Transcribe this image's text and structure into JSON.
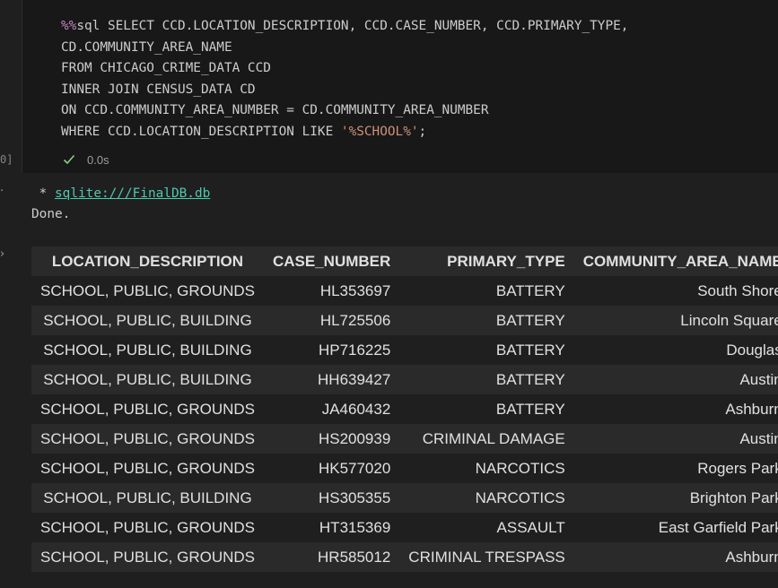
{
  "cell": {
    "code_lines": [
      [
        "%%",
        "sql SELECT CCD.LOCATION_DESCRIPTION, CCD.CASE_NUMBER, CCD.PRIMARY_TYPE,"
      ],
      [
        "",
        "CD.COMMUNITY_AREA_NAME"
      ],
      [
        "",
        "FROM CHICAGO_CRIME_DATA CCD"
      ],
      [
        "",
        "INNER JOIN CENSUS_DATA CD"
      ],
      [
        "",
        "ON CCD.COMMUNITY_AREA_NUMBER = CD.COMMUNITY_AREA_NUMBER"
      ]
    ],
    "where_prefix": "WHERE CCD.LOCATION_DESCRIPTION LIKE ",
    "where_string": "'%SCHOOL%'",
    "where_suffix": ";",
    "exec_count_fragment": "0]",
    "status_icon": "check-icon",
    "exec_time": "0.0s"
  },
  "output": {
    "conn_prefix": " * ",
    "conn_link": "sqlite:///FinalDB.db",
    "done_text": "Done."
  },
  "table": {
    "columns": [
      "LOCATION_DESCRIPTION",
      "CASE_NUMBER",
      "PRIMARY_TYPE",
      "COMMUNITY_AREA_NAME"
    ],
    "rows": [
      [
        "SCHOOL, PUBLIC, GROUNDS",
        "HL353697",
        "BATTERY",
        "South Shore"
      ],
      [
        "SCHOOL, PUBLIC, BUILDING",
        "HL725506",
        "BATTERY",
        "Lincoln Square"
      ],
      [
        "SCHOOL, PUBLIC, BUILDING",
        "HP716225",
        "BATTERY",
        "Douglas"
      ],
      [
        "SCHOOL, PUBLIC, BUILDING",
        "HH639427",
        "BATTERY",
        "Austin"
      ],
      [
        "SCHOOL, PUBLIC, GROUNDS",
        "JA460432",
        "BATTERY",
        "Ashburn"
      ],
      [
        "SCHOOL, PUBLIC, GROUNDS",
        "HS200939",
        "CRIMINAL DAMAGE",
        "Austin"
      ],
      [
        "SCHOOL, PUBLIC, GROUNDS",
        "HK577020",
        "NARCOTICS",
        "Rogers Park"
      ],
      [
        "SCHOOL, PUBLIC, BUILDING",
        "HS305355",
        "NARCOTICS",
        "Brighton Park"
      ],
      [
        "SCHOOL, PUBLIC, GROUNDS",
        "HT315369",
        "ASSAULT",
        "East Garfield Park"
      ],
      [
        "SCHOOL, PUBLIC, GROUNDS",
        "HR585012",
        "CRIMINAL TRESPASS",
        "Ashburn"
      ]
    ]
  },
  "colors": {
    "background": "#1f1f1f",
    "cell_background": "#181818",
    "magic": "#c586c0",
    "string": "#ce9178",
    "link": "#4ec9b0",
    "check": "#89d185",
    "row_stripe": "#2a2a2a"
  }
}
